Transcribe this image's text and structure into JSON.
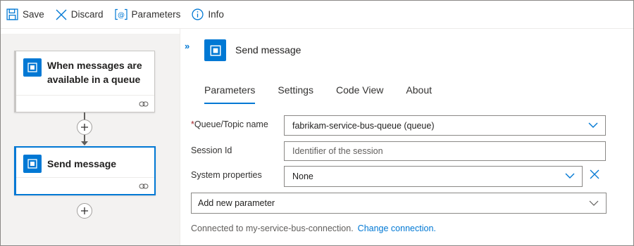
{
  "toolbar": {
    "save": "Save",
    "discard": "Discard",
    "parameters": "Parameters",
    "info": "Info"
  },
  "designer": {
    "trigger": {
      "title": "When messages are available in a queue",
      "icon": "service-bus-icon"
    },
    "action": {
      "title": "Send message",
      "icon": "service-bus-icon"
    }
  },
  "panel": {
    "title": "Send message",
    "collapse": "»",
    "tabs": [
      {
        "label": "Parameters",
        "active": true
      },
      {
        "label": "Settings",
        "active": false
      },
      {
        "label": "Code View",
        "active": false
      },
      {
        "label": "About",
        "active": false
      }
    ],
    "fields": {
      "queue": {
        "required_mark": "*",
        "label": "Queue/Topic name",
        "value": "fabrikam-service-bus-queue (queue)"
      },
      "session": {
        "label": "Session Id",
        "placeholder": "Identifier of the session"
      },
      "system": {
        "label": "System properties",
        "value": "None"
      },
      "add_param": {
        "value": "Add new parameter"
      }
    },
    "connection": {
      "text": "Connected to my-service-bus-connection.",
      "link": "Change connection."
    }
  },
  "colors": {
    "accent": "#0078d4",
    "required": "#a4262c"
  }
}
